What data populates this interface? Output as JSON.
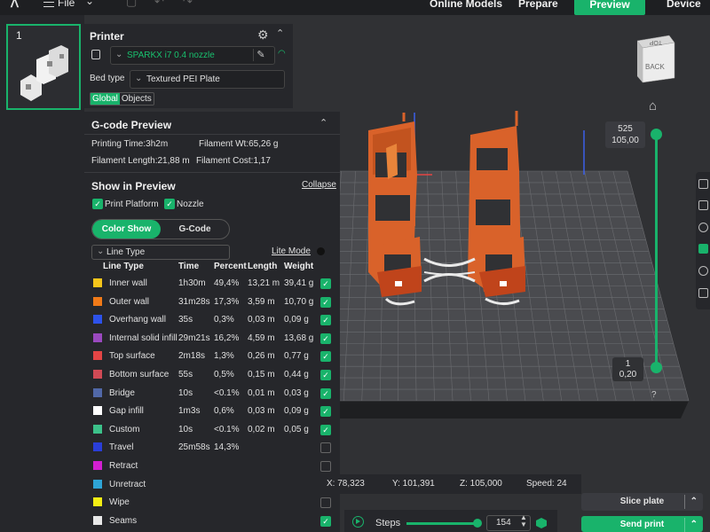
{
  "topbar": {
    "menu_label": "File",
    "tabs": [
      {
        "label": "Online Models"
      },
      {
        "label": "Prepare"
      },
      {
        "label": "Preview",
        "active": true
      },
      {
        "label": "Device"
      }
    ]
  },
  "plate": {
    "number": "1"
  },
  "printer": {
    "title": "Printer",
    "printer_name": "SPARKX i7 0.4 nozzle",
    "bed_type_label": "Bed type",
    "bed_type": "Textured PEI Plate",
    "tabs": [
      "Global",
      "Objects"
    ]
  },
  "gcode": {
    "title": "G-code Preview",
    "printing_time": "Printing Time:3h2m",
    "filament_wt": "Filament Wt:65,26 g",
    "filament_length": "Filament Length:21,88 m",
    "filament_cost": "Filament Cost:1,17",
    "show_title": "Show in Preview",
    "collapse_label": "Collapse",
    "print_platform_label": "Print Platform",
    "nozzle_label": "Nozzle",
    "color_show_label": "Color Show",
    "gcode_label": "G-Code",
    "line_type_select": "Line Type",
    "lite_mode_label": "Lite Mode",
    "columns": [
      "Line Type",
      "Time",
      "Percent",
      "Length",
      "Weight"
    ],
    "rows": [
      {
        "name": "Inner wall",
        "time": "1h30m",
        "percent": "49,4%",
        "length": "13,21 m",
        "weight": "39,41 g",
        "color": "#f5c51b",
        "checked": true
      },
      {
        "name": "Outer wall",
        "time": "31m28s",
        "percent": "17,3%",
        "length": "3,59 m",
        "weight": "10,70 g",
        "color": "#f07a18",
        "checked": true
      },
      {
        "name": "Overhang wall",
        "time": "35s",
        "percent": "0,3%",
        "length": "0,03 m",
        "weight": "0,09 g",
        "color": "#2d52ea",
        "checked": true
      },
      {
        "name": "Internal solid infill",
        "time": "29m21s",
        "percent": "16,2%",
        "length": "4,59 m",
        "weight": "13,68 g",
        "color": "#9a49bf",
        "checked": true
      },
      {
        "name": "Top surface",
        "time": "2m18s",
        "percent": "1,3%",
        "length": "0,26 m",
        "weight": "0,77 g",
        "color": "#e34545",
        "checked": true
      },
      {
        "name": "Bottom surface",
        "time": "55s",
        "percent": "0,5%",
        "length": "0,15 m",
        "weight": "0,44 g",
        "color": "#d04a55",
        "checked": true
      },
      {
        "name": "Bridge",
        "time": "10s",
        "percent": "<0.1%",
        "length": "0,01 m",
        "weight": "0,03 g",
        "color": "#5168a8",
        "checked": true
      },
      {
        "name": "Gap infill",
        "time": "1m3s",
        "percent": "0,6%",
        "length": "0,03 m",
        "weight": "0,09 g",
        "color": "#ffffff",
        "checked": true
      },
      {
        "name": "Custom",
        "time": "10s",
        "percent": "<0.1%",
        "length": "0,02 m",
        "weight": "0,05 g",
        "color": "#3cc18a",
        "checked": true
      },
      {
        "name": "Travel",
        "time": "25m58s",
        "percent": "14,3%",
        "length": "",
        "weight": "",
        "color": "#2a3ed8",
        "checked": false
      },
      {
        "name": "Retract",
        "time": "",
        "percent": "",
        "length": "",
        "weight": "",
        "color": "#d21fd0",
        "checked": false
      },
      {
        "name": "Unretract",
        "time": "",
        "percent": "",
        "length": "",
        "weight": "",
        "color": "#2ea4d6",
        "checked": false
      },
      {
        "name": "Wipe",
        "time": "",
        "percent": "",
        "length": "",
        "weight": "",
        "color": "#f4ee14",
        "checked": false
      },
      {
        "name": "Seams",
        "time": "",
        "percent": "",
        "length": "",
        "weight": "",
        "color": "#e8e8e8",
        "checked": true
      }
    ]
  },
  "layer_slider": {
    "top_layer": "525",
    "top_height": "105,00",
    "bottom_layer": "1",
    "bottom_height": "0,20",
    "help": "?"
  },
  "navcube": {
    "top_label": "TOP",
    "back_label": "BACK"
  },
  "coords": {
    "x": "X: 78,323",
    "y": "Y: 101,391",
    "z": "Z: 105,000",
    "speed": "Speed: 24"
  },
  "steps": {
    "label": "Steps",
    "value": "154"
  },
  "actions": {
    "slice": "Slice plate",
    "send": "Send print"
  },
  "colors": {
    "accent": "#19b36b",
    "panel": "#26272b",
    "background": "#303134",
    "model_orange": "#e0672a"
  }
}
